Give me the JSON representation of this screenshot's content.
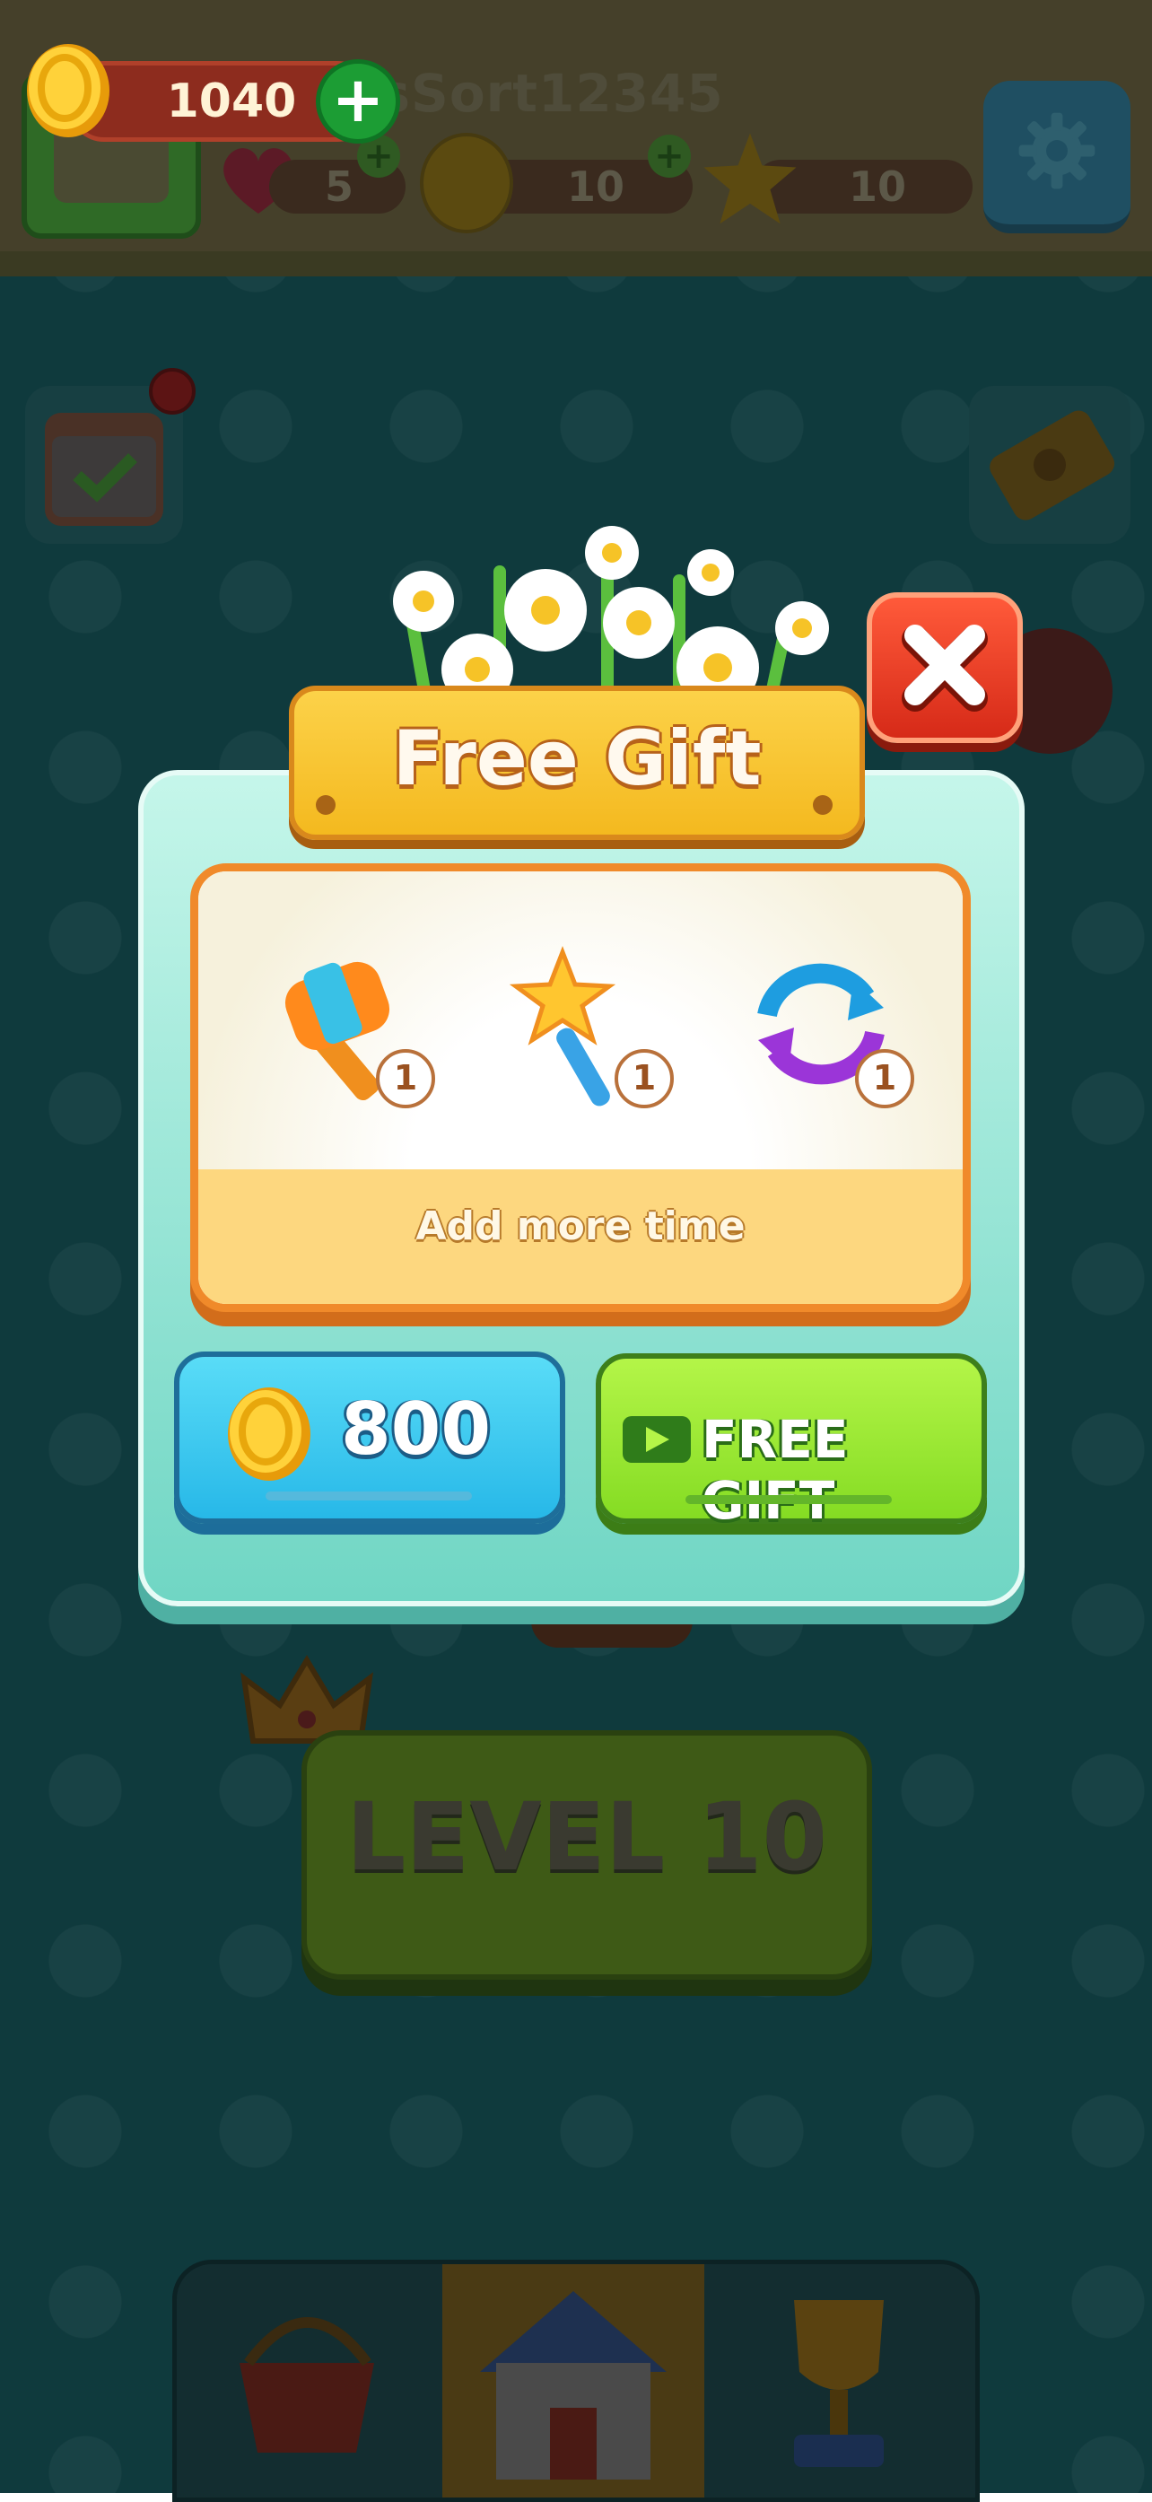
{
  "header": {
    "coins": "1040",
    "username": "dsSort12345",
    "lives": "5",
    "coins_small": "10",
    "stars": "10"
  },
  "popup": {
    "title": "Free Gift",
    "items": [
      {
        "name": "hammer",
        "count": "1"
      },
      {
        "name": "magic-wand",
        "count": "1"
      },
      {
        "name": "shuffle",
        "count": "1"
      }
    ],
    "description": "Add more time",
    "price": "800",
    "free_label": "FREE GIFT"
  },
  "level": {
    "label": "LEVEL 10"
  },
  "nav": {
    "tabs": [
      "shop-icon",
      "home-icon",
      "trophy-icon"
    ],
    "active": "home"
  },
  "colors": {
    "accent_green": "#85dc23",
    "accent_blue": "#27b8e8",
    "banner_yellow": "#f4b91f",
    "close_red": "#d62a18"
  }
}
